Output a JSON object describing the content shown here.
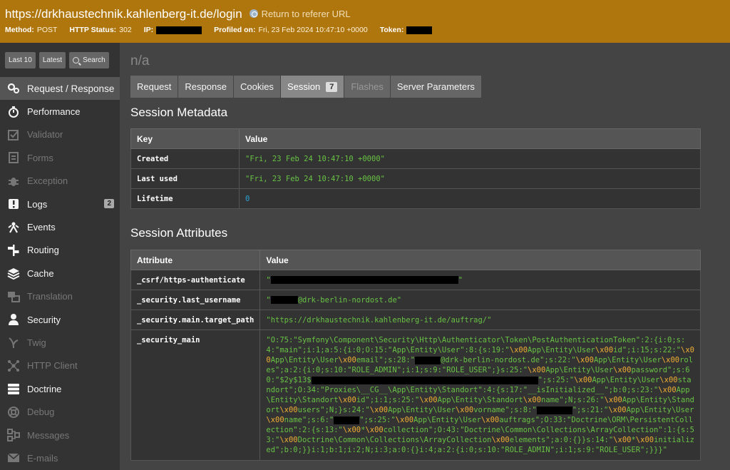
{
  "header": {
    "url": "https://drkhaustechnik.kahlenberg-it.de/login",
    "return_link": "Return to referer URL",
    "method_label": "Method:",
    "method": "POST",
    "status_label": "HTTP Status:",
    "status": "302",
    "ip_label": "IP:",
    "profiled_label": "Profiled on:",
    "profiled": "Fri, 23 Feb 2024 10:47:10 +0000",
    "token_label": "Token:"
  },
  "shortcuts": {
    "last10": "Last 10",
    "latest": "Latest",
    "search": "Search"
  },
  "sidebar": {
    "items": [
      {
        "label": "Request / Response",
        "icon": "request-icon",
        "state": "active"
      },
      {
        "label": "Performance",
        "icon": "stopwatch-icon",
        "state": "normal"
      },
      {
        "label": "Validator",
        "icon": "checkbox-icon",
        "state": "disabled"
      },
      {
        "label": "Forms",
        "icon": "form-icon",
        "state": "disabled"
      },
      {
        "label": "Exception",
        "icon": "bug-icon",
        "state": "disabled"
      },
      {
        "label": "Logs",
        "icon": "alert-icon",
        "state": "normal",
        "count": "2"
      },
      {
        "label": "Events",
        "icon": "events-icon",
        "state": "normal"
      },
      {
        "label": "Routing",
        "icon": "route-icon",
        "state": "normal"
      },
      {
        "label": "Cache",
        "icon": "layers-icon",
        "state": "normal"
      },
      {
        "label": "Translation",
        "icon": "translation-icon",
        "state": "disabled"
      },
      {
        "label": "Security",
        "icon": "user-icon",
        "state": "normal"
      },
      {
        "label": "Twig",
        "icon": "twig-icon",
        "state": "disabled"
      },
      {
        "label": "HTTP Client",
        "icon": "network-icon",
        "state": "disabled"
      },
      {
        "label": "Doctrine",
        "icon": "database-icon",
        "state": "normal"
      },
      {
        "label": "Debug",
        "icon": "lifebuoy-icon",
        "state": "disabled"
      },
      {
        "label": "Messages",
        "icon": "messages-icon",
        "state": "disabled"
      },
      {
        "label": "E-mails",
        "icon": "envelope-icon",
        "state": "disabled"
      }
    ]
  },
  "page": {
    "title": "n/a",
    "tabs": [
      {
        "label": "Request",
        "state": "normal"
      },
      {
        "label": "Response",
        "state": "normal"
      },
      {
        "label": "Cookies",
        "state": "normal"
      },
      {
        "label": "Session",
        "state": "active",
        "badge": "7"
      },
      {
        "label": "Flashes",
        "state": "disabled"
      },
      {
        "label": "Server Parameters",
        "state": "normal"
      }
    ]
  },
  "metadata": {
    "heading": "Session Metadata",
    "col_key": "Key",
    "col_value": "Value",
    "rows": [
      {
        "key": "Created",
        "value": "\"Fri, 23 Feb 24 10:47:10 +0000\""
      },
      {
        "key": "Last used",
        "value": "\"Fri, 23 Feb 24 10:47:10 +0000\""
      },
      {
        "key": "Lifetime",
        "value": "0"
      }
    ]
  },
  "attributes": {
    "heading": "Session Attributes",
    "col_attr": "Attribute",
    "col_value": "Value",
    "csrf_key": "_csrf/https-authenticate",
    "username_key": "_security.last_username",
    "username_suffix": "@drk-berlin-nordost.de\"",
    "target_key": "_security.main.target_path",
    "target_value": "\"https://drkhaustechnik.kahlenberg-it.de/auftrag/\"",
    "main_key": "_security_main",
    "main_value": {
      "p1": "\"O:75:\"Symfony\\Component\\Security\\Http\\Authenticator\\Token\\PostAuthenticationToken\":2:{i:0;s:4:\"main\";i:1;a:5:{i:0;O:15:\"App\\Entity\\User\":8:{s:19:\"",
      "p2": "App\\Entity\\User",
      "p3": "id\";i:15;s:22:\"",
      "p4": "App\\Entity\\User",
      "p5": "email\";s:28:\"",
      "p6": "@drk-berlin-nordost.de\";s:22:\"",
      "p7": "App\\Entity\\User",
      "p8": "roles\";a:2:{i:0;s:10:\"ROLE_ADMIN\";i:1;s:9:\"ROLE_USER\";}s:25:\"",
      "p9": "App\\Entity\\User",
      "p10": "password\";s:60:\"$2y$13$",
      "p11": "\";s:25:\"",
      "p12": "App\\Entity\\User",
      "p13": "standort\";O:34:\"Proxies\\__CG__\\App\\Entity\\Standort\":4:{s:17:\"__isInitialized__\";b:0;s:23:\"",
      "p14": "App\\Entity\\Standort",
      "p15": "id\";i:1;s:25:\"",
      "p16": "App\\Entity\\Standort",
      "p17": "name\";N;s:26:\"",
      "p18": "App\\Entity\\Standort",
      "p19": "users\";N;}s:24:\"",
      "p20": "App\\Entity\\User",
      "p21": "vorname\";s:8:\"",
      "p22": "\";s:21:\"",
      "p23": "App\\Entity\\User",
      "p24": "name\";s:6:\"",
      "p25": "\";s:25:\"",
      "p26": "App\\Entity\\User",
      "p27": "auftrags\";O:33:\"Doctrine\\ORM\\PersistentCollection\":2:{s:13:\"",
      "p28": "*",
      "p29": "collection\";O:43:\"Doctrine\\Common\\Collections\\ArrayCollection\":1:{s:53:\"",
      "p30": "Doctrine\\Common\\Collections\\ArrayCollection",
      "p31": "elements\";a:0:{}}s:14:\"",
      "p32": "*",
      "p33": "initialized\";b:0;}}i:1;b:1;i:2;N;i:3;a:0:{}i:4;a:2:{i:0;s:10:\"ROLE_ADMIN\";i:1;s:9:\"ROLE_USER\";}}}\"",
      "x00": "\\x00"
    }
  }
}
